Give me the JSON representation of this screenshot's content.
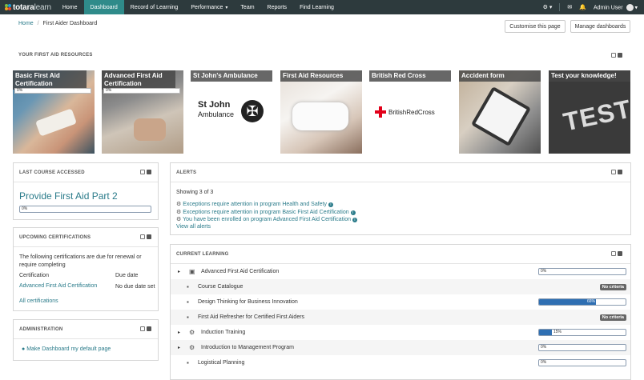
{
  "brand": {
    "name_bold": "totara",
    "name_light": "learn"
  },
  "nav": {
    "items": [
      {
        "label": "Home"
      },
      {
        "label": "Dashboard"
      },
      {
        "label": "Record of Learning"
      },
      {
        "label": "Performance"
      },
      {
        "label": "Team"
      },
      {
        "label": "Reports"
      },
      {
        "label": "Find Learning"
      }
    ],
    "active": "Dashboard",
    "user": "Admin User"
  },
  "breadcrumb": {
    "home": "Home",
    "sep": "/",
    "current": "First Aider Dashboard"
  },
  "buttons": {
    "customise": "Customise this page",
    "manage": "Manage dashboards"
  },
  "resources": {
    "heading": "YOUR FIRST AID RESOURCES",
    "tiles": [
      {
        "title": "Basic First Aid Certification",
        "progress": "0%",
        "icon": "bandaging-photo"
      },
      {
        "title": "Advanced First Aid Certification",
        "progress": "0%",
        "icon": "cpr-photo"
      },
      {
        "title": "St John's Ambulance",
        "logo_line1": "St John",
        "logo_line2": "Ambulance",
        "icon": "st-john-logo"
      },
      {
        "title": "First Aid Resources",
        "icon": "bandage-foot-photo"
      },
      {
        "title": "British Red Cross",
        "logo_text": "BritishRedCross",
        "icon": "red-cross-logo"
      },
      {
        "title": "Accident form",
        "icon": "tablet-form-photo"
      },
      {
        "title": "Test your knowledge!",
        "chalk_text": "TEST",
        "icon": "chalkboard-photo"
      }
    ]
  },
  "last_course": {
    "heading": "LAST COURSE ACCESSED",
    "course": "Provide First Aid Part 2",
    "progress": "0%"
  },
  "upcoming": {
    "heading": "UPCOMING CERTIFICATIONS",
    "intro": "The following certifications are due for renewal or require completing",
    "col_cert": "Certification",
    "col_due": "Due date",
    "row_cert": "Advanced First Aid Certification",
    "row_due": "No due date set",
    "all_link": "All certifications"
  },
  "admin": {
    "heading": "ADMINISTRATION",
    "link": "Make Dashboard my default page"
  },
  "alerts": {
    "heading": "ALERTS",
    "showing": "Showing 3 of 3",
    "items": [
      "Exceptions require attention in program Health and Safety",
      "Exceptions require attention in program Basic First Aid Certification",
      "You have been enrolled on program Advanced First Aid Certification"
    ],
    "view_all": "View all alerts"
  },
  "current_learning": {
    "heading": "CURRENT LEARNING",
    "rows": [
      {
        "name": "Advanced First Aid Certification",
        "expandable": true,
        "icon": "certification-icon",
        "progress_label": "0%",
        "progress": 0
      },
      {
        "name": "Course Catalogue",
        "expandable": false,
        "icon": "course-icon",
        "badge": "No criteria"
      },
      {
        "name": "Design Thinking for Business Innovation",
        "expandable": false,
        "icon": "course-icon",
        "progress_label": "66%",
        "progress": 66
      },
      {
        "name": "First Aid Refresher for Certified First Aiders",
        "expandable": false,
        "icon": "course-icon",
        "badge": "No criteria"
      },
      {
        "name": "Induction Training",
        "expandable": true,
        "icon": "program-icon",
        "progress_label": "15%",
        "progress": 15
      },
      {
        "name": "Introduction to Management Program",
        "expandable": true,
        "icon": "program-icon",
        "progress_label": "0%",
        "progress": 0
      },
      {
        "name": "Logistical Planning",
        "expandable": false,
        "icon": "course-icon",
        "progress_label": "0%",
        "progress": 0
      }
    ]
  },
  "colors": {
    "topbar": "#2d3a3d",
    "accent": "#2f8b8a",
    "link": "#2a7b8a",
    "progress": "#2f6fb2",
    "badge": "#666666"
  }
}
